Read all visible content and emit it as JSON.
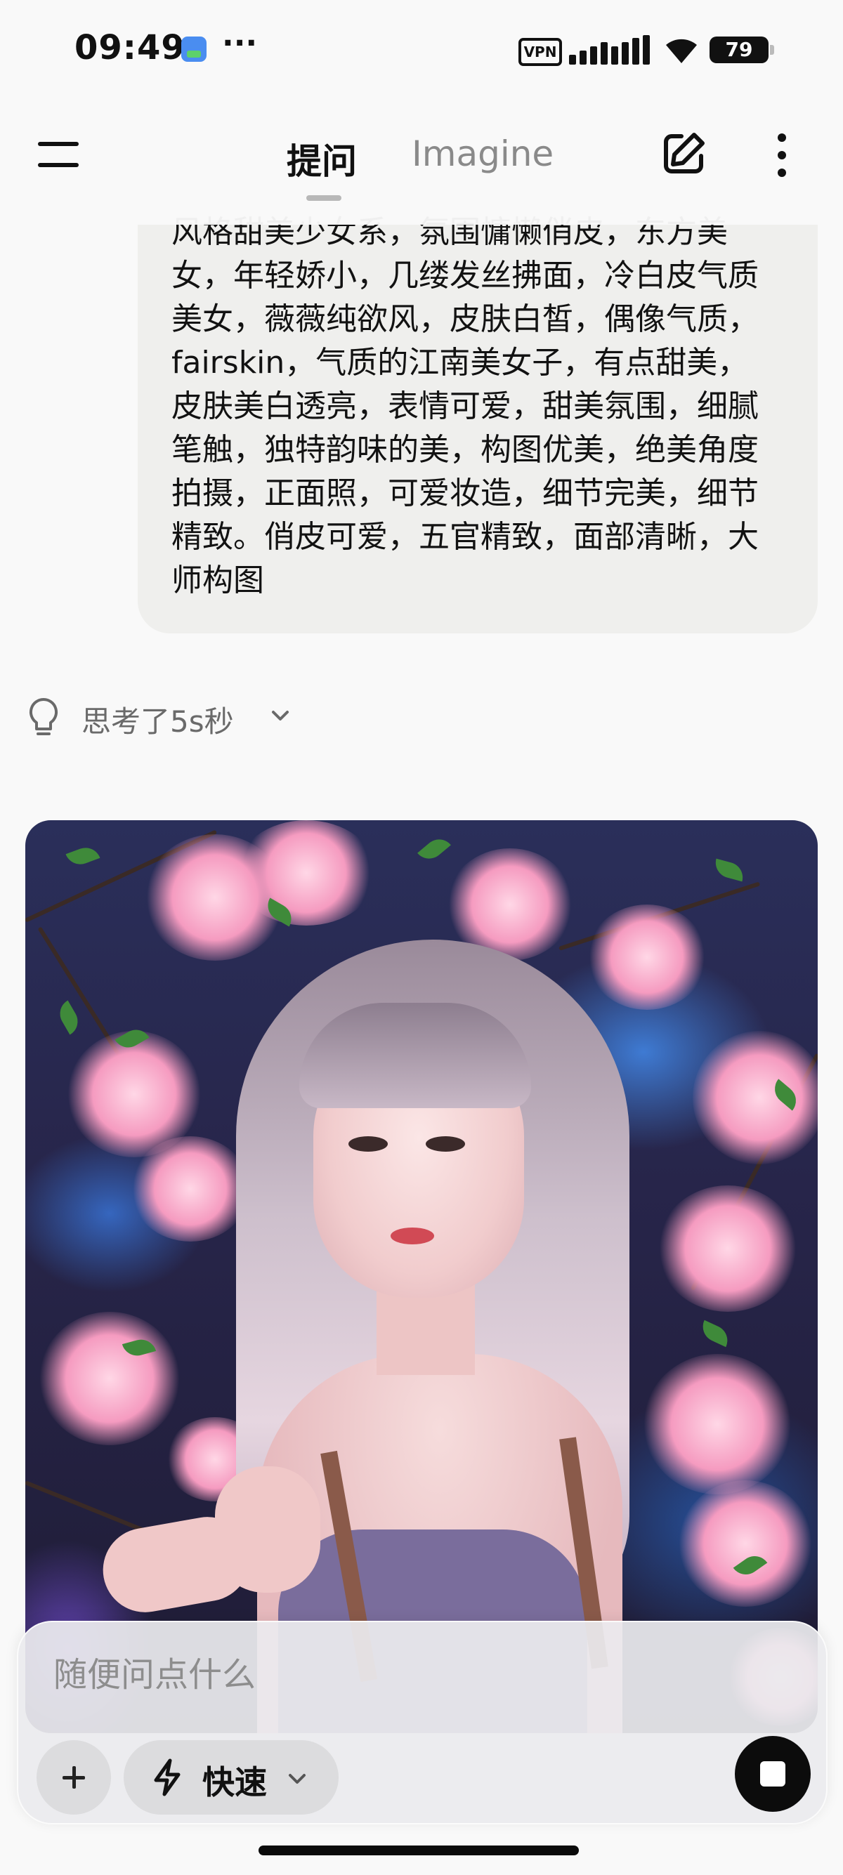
{
  "status_bar": {
    "time": "09:49",
    "more": "···",
    "vpn": "VPN",
    "battery": "79"
  },
  "header": {
    "tab_ask": "提问",
    "tab_imagine": "Imagine",
    "icons": [
      "menu-icon",
      "compose-icon",
      "kebab-icon"
    ]
  },
  "conversation": {
    "user_prompt": "风格甜美少女系，氛围慵懒俏皮，东方美女，年轻娇小，几缕发丝拂面，冷白皮气质美女，薇薇纯欲风，皮肤白皙，偶像气质，fairskin，气质的江南美女子，有点甜美，皮肤美白透亮，表情可爱，甜美氛围，细腻笔触，独特韵味的美，构图优美，绝美角度拍摄，正面照，可爱妆造，细节完美，细节精致。俏皮可爱，五官精致，面部清晰，大师构图",
    "thinking_label": "思考了5s秒"
  },
  "composer": {
    "placeholder": "随便问点什么",
    "mode_label": "快速"
  },
  "colors": {
    "background": "#f9f9f9",
    "bubble": "#efefed",
    "stop_button": "#0c0c0c",
    "muted_text": "#8a8a8a"
  }
}
